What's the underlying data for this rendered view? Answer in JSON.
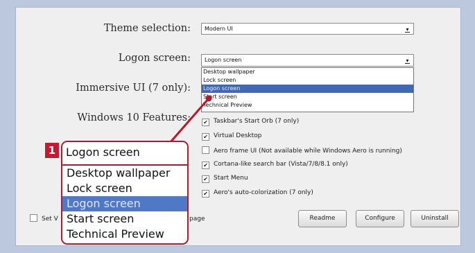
{
  "labels": {
    "theme": "Theme selection:",
    "logon": "Logon screen:",
    "immersive": "Immersive UI (7 only):",
    "win10": "Windows 10 Features:"
  },
  "theme_combo": {
    "value": "Modern UI"
  },
  "logon_combo": {
    "value": "Logon screen"
  },
  "dropdown": {
    "options": [
      "Desktop wallpaper",
      "Lock screen",
      "Logon screen",
      "Start screen",
      "Technical Preview"
    ],
    "selected": "Logon screen"
  },
  "features": [
    {
      "label": "Taskbar's Start Orb (7 only)",
      "checked": true
    },
    {
      "label": "Virtual Desktop",
      "checked": true
    },
    {
      "label": "Aero frame UI (Not available while Windows Aero is running)",
      "checked": false
    },
    {
      "label": "Cortana-like search bar (Vista/7/8/8.1 only)",
      "checked": true
    },
    {
      "label": "Start Menu",
      "checked": true
    },
    {
      "label": "Aero's auto-colorization (7 only)",
      "checked": true
    }
  ],
  "bottom": {
    "set_checkbox_prefix": "Set V",
    "set_checkbox_suffix": "page",
    "readme": "Readme",
    "configure": "Configure",
    "uninstall": "Uninstall"
  },
  "callout": {
    "badge": "1",
    "header": "Logon screen",
    "options": [
      "Desktop wallpaper",
      "Lock screen",
      "Logon screen",
      "Start screen",
      "Technical Preview"
    ],
    "selected": "Logon screen"
  },
  "colors": {
    "accent_red": "#b3182d",
    "selection_blue": "#4168b4",
    "background": "#bcc8dd"
  }
}
